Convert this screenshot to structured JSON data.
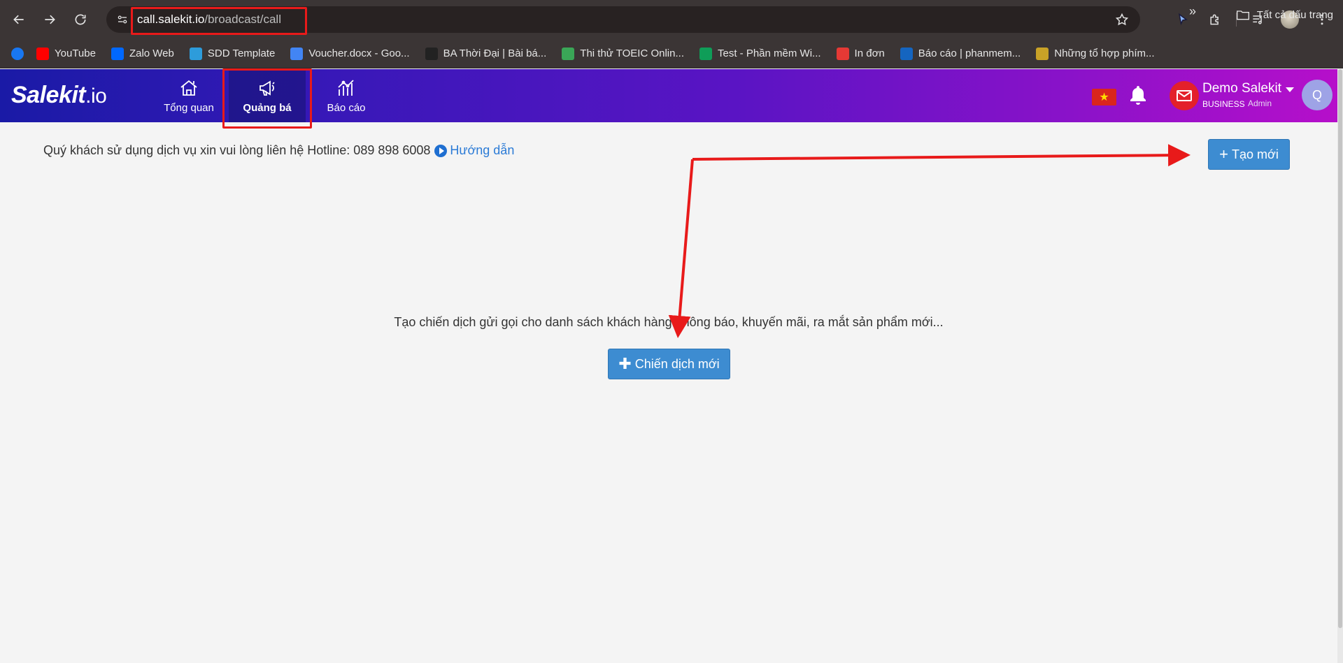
{
  "browser": {
    "url_host": "call.salekit.io",
    "url_path": "/broadcast/call",
    "bookmarks": [
      {
        "label": "",
        "icon": "facebook-icon",
        "color": "#1877f2"
      },
      {
        "label": "YouTube",
        "icon": "youtube-icon",
        "color": "#ff0000"
      },
      {
        "label": "Zalo Web",
        "icon": "zalo-icon",
        "color": "#0068ff"
      },
      {
        "label": "SDD Template",
        "icon": "template-icon",
        "color": "#2d9cdb"
      },
      {
        "label": "Voucher.docx - Goo...",
        "icon": "docs-icon",
        "color": "#4285f4"
      },
      {
        "label": "BA Thời Đại | Bài bá...",
        "icon": "ba-icon",
        "color": "#222222"
      },
      {
        "label": "Thi thử TOEIC Onlin...",
        "icon": "toeic-icon",
        "color": "#3aa657"
      },
      {
        "label": "Test - Phần mềm Wi...",
        "icon": "sheets-icon",
        "color": "#0f9d58"
      },
      {
        "label": "In đơn",
        "icon": "print-icon",
        "color": "#e53935"
      },
      {
        "label": "Báo cáo | phanmem...",
        "icon": "report-icon",
        "color": "#1565c0"
      },
      {
        "label": "Những tổ hợp phím...",
        "icon": "keyboard-icon",
        "color": "#c9a227"
      }
    ],
    "bookmarks_more": "»",
    "all_bookmarks": "Tất cả dấu trang"
  },
  "header": {
    "logo_main": "Salekit",
    "logo_suffix": ".io",
    "nav": [
      {
        "label": "Tổng quan",
        "icon": "home-icon"
      },
      {
        "label": "Quảng bá",
        "icon": "megaphone-icon",
        "active": true
      },
      {
        "label": "Báo cáo",
        "icon": "chart-icon"
      }
    ],
    "flag_icon": "vietnam-flag-icon",
    "user_name": "Demo Salekit",
    "user_plan": "BUSINESS",
    "user_role": "Admin",
    "avatar_letter": "Q"
  },
  "main": {
    "hotline_text": "Quý khách sử dụng dịch vụ xin vui lòng liên hệ Hotline: 089 898 6008",
    "guide_label": "Hướng dẫn",
    "create_button_label": "Tạo mới",
    "empty_message": "Tạo chiến dịch gửi gọi cho danh sách khách hàng: thông báo, khuyến mãi, ra mắt sản phẩm mới...",
    "new_campaign_label": "Chiến dịch mới"
  },
  "colors": {
    "accent_button": "#3d8cd1",
    "annotation_red": "#e81a1a",
    "link_blue": "#2b7bd6"
  }
}
